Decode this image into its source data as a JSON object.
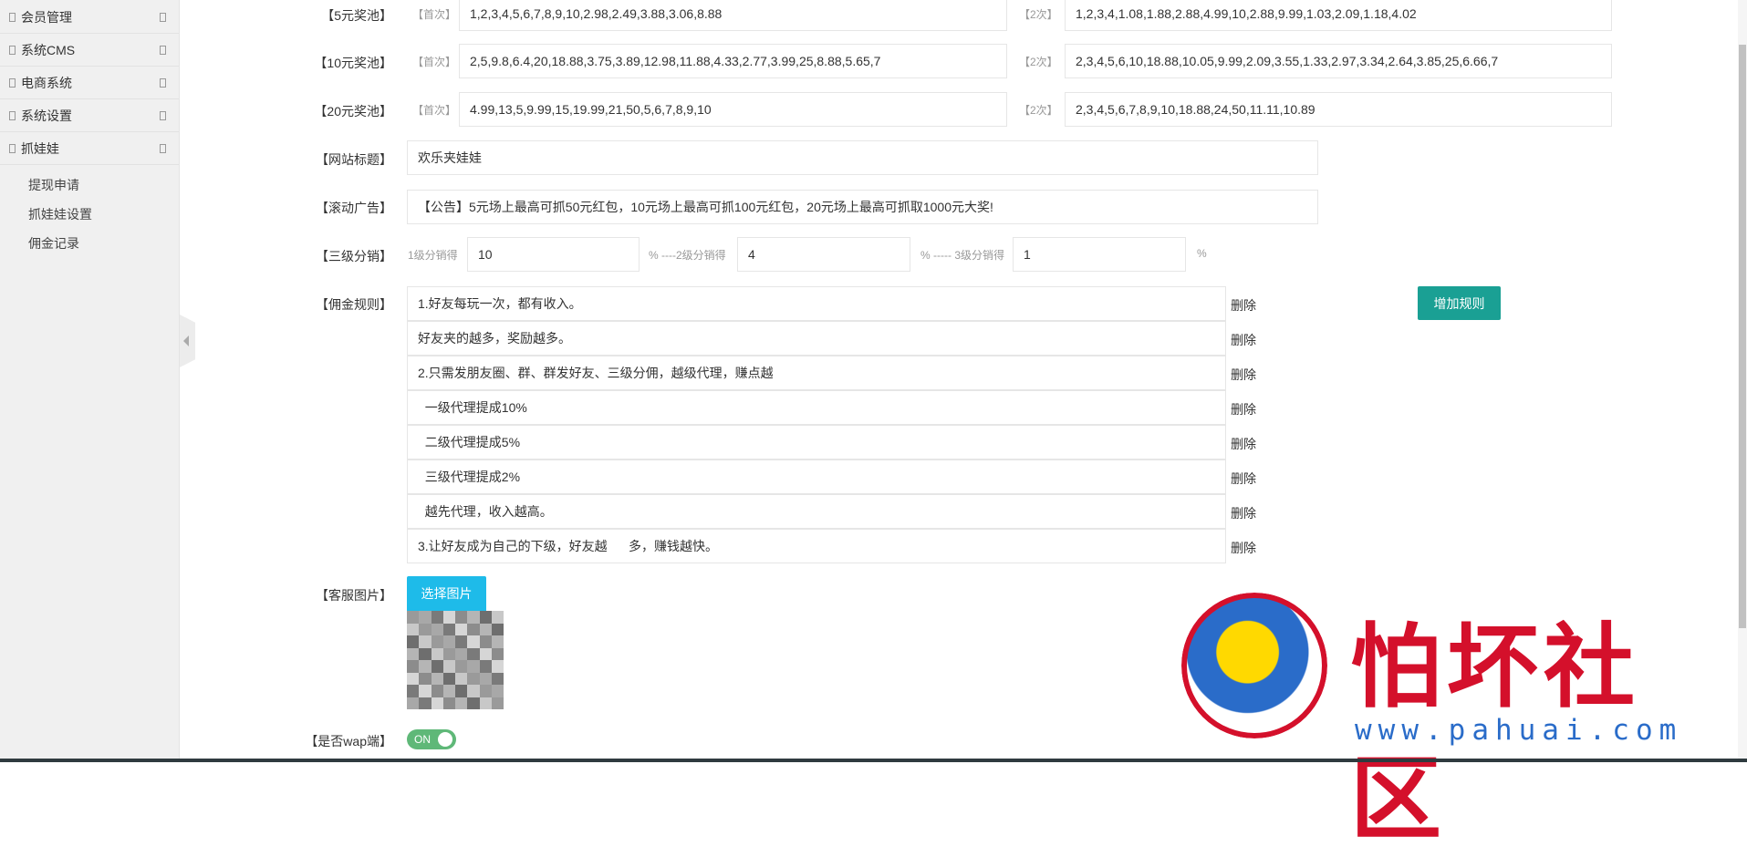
{
  "sidebar": {
    "items": [
      {
        "label": "会员管理"
      },
      {
        "label": "系统CMS"
      },
      {
        "label": "电商系统"
      },
      {
        "label": "系统设置"
      },
      {
        "label": "抓娃娃"
      }
    ],
    "subitems": [
      {
        "label": "提现申请"
      },
      {
        "label": "抓娃娃设置"
      },
      {
        "label": "佣金记录"
      }
    ]
  },
  "form": {
    "first_tag": "【首次】",
    "second_tag": "【2次】",
    "pools": [
      {
        "label": "【5元奖池】",
        "first": "1,2,3,4,5,6,7,8,9,10,2.98,2.49,3.88,3.06,8.88",
        "second": "1,2,3,4,1.08,1.88,2.88,4.99,10,2.88,9.99,1.03,2.09,1.18,4.02"
      },
      {
        "label": "【10元奖池】",
        "first": "2,5,9.8,6.4,20,18.88,3.75,3.89,12.98,11.88,4.33,2.77,3.99,25,8.88,5.65,7",
        "second": "2,3,4,5,6,10,18.88,10.05,9.99,2.09,3.55,1.33,2.97,3.34,2.64,3.85,25,6.66,7"
      },
      {
        "label": "【20元奖池】",
        "first": "4.99,13,5,9.99,15,19.99,21,50,5,6,7,8,9,10",
        "second": "2,3,4,5,6,7,8,9,10,18.88,24,50,11.11,10.89"
      }
    ],
    "site_title": {
      "label": "【网站标题】",
      "value": "欢乐夹娃娃"
    },
    "scroll_ad": {
      "label": "【滚动广告】",
      "value": "【公告】5元场上最高可抓50元红包，10元场上最高可抓100元红包，20元场上最高可抓取1000元大奖!"
    },
    "distribution": {
      "label": "【三级分销】",
      "l1_label": "1级分销得",
      "l1": "10",
      "l2_label": "% ----2级分销得",
      "l2": "4",
      "l3_label": "% ----- 3级分销得",
      "l3": "1",
      "pct": "%"
    },
    "rules": {
      "label": "【佣金规则】",
      "delete": "删除",
      "add": "增加规则",
      "items": [
        "1.好友每玩一次，都有收入。",
        "好友夹的越多，奖励越多。",
        "2.只需发朋友圈、群、群发好友、三级分佣，越级代理，赚点越",
        "  一级代理提成10%",
        "  二级代理提成5%",
        "  三级代理提成2%",
        "  越先代理，收入越高。",
        "3.让好友成为自己的下级，好友越      多，赚钱越快。"
      ]
    },
    "service_image": {
      "label": "【客服图片】",
      "button": "选择图片"
    },
    "wap": {
      "label": "【是否wap端】",
      "state": "ON"
    }
  },
  "watermark": {
    "title": "怕坏社区",
    "url": "www.pahuai.com"
  }
}
